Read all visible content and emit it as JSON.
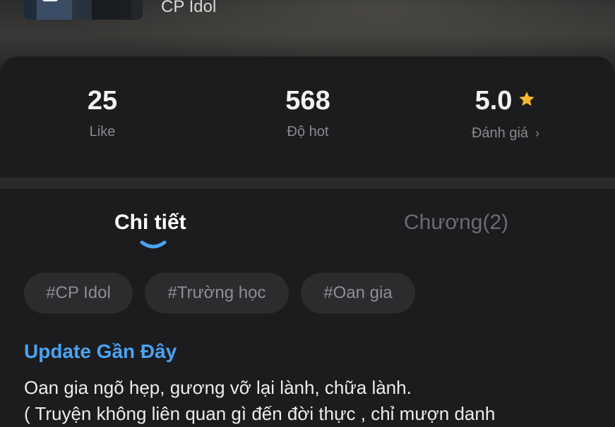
{
  "header": {
    "author_name": "CP Idol"
  },
  "stats": {
    "like": {
      "value": "25",
      "label": "Like"
    },
    "hot": {
      "value": "568",
      "label": "Độ hot"
    },
    "rating": {
      "value": "5.0",
      "label": "Đánh giá",
      "chevron": "›",
      "icon": "star-icon"
    }
  },
  "tabs": [
    {
      "label": "Chi tiết",
      "active": true
    },
    {
      "label": "Chương(2)",
      "active": false
    }
  ],
  "tags": [
    "#CP Idol",
    "#Trường học",
    "#Oan gia"
  ],
  "update": {
    "title": "Update Gần Đây",
    "lines": [
      "Oan gia ngõ hẹp, gương vỡ lại lành, chữa lành.",
      "( Truyện không liên quan gì đến đời thực , chỉ mượn danh"
    ]
  },
  "colors": {
    "background": "#1c1c1e",
    "accent_link": "#4aa3f2",
    "star": "#f5b82e",
    "muted_text": "#8a8a8e",
    "tag_background": "#2c2c2e",
    "tab_indicator": "#4aa3f2"
  }
}
